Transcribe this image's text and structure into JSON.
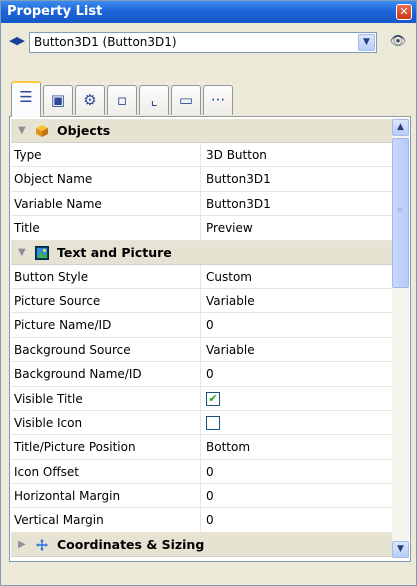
{
  "window": {
    "title": "Property List",
    "close_glyph": "✕"
  },
  "selector": {
    "nav_glyph": "◀▶",
    "selected_object": "Button3D1 (Button3D1)",
    "dropdown_glyph": "▼",
    "eye_glyph": "👁"
  },
  "tabs": [
    {
      "icon": "list-icon",
      "glyph": "☰",
      "active": true
    },
    {
      "icon": "panel-icon",
      "glyph": "▣",
      "active": false
    },
    {
      "icon": "gear-icon",
      "glyph": "⚙",
      "active": false
    },
    {
      "icon": "shapes-icon",
      "glyph": "▫",
      "active": false
    },
    {
      "icon": "chart-icon",
      "glyph": "⌞",
      "active": false
    },
    {
      "icon": "monitor-icon",
      "glyph": "▭",
      "active": false
    },
    {
      "icon": "more-icon",
      "glyph": "···",
      "active": false
    }
  ],
  "grid": {
    "objects": {
      "label": "Objects",
      "toggle": "▼",
      "rows": [
        {
          "name": "Type",
          "value": "3D Button"
        },
        {
          "name": "Object Name",
          "value": "Button3D1"
        },
        {
          "name": "Variable Name",
          "value": "Button3D1"
        },
        {
          "name": "Title",
          "value": "Preview"
        }
      ]
    },
    "text_picture": {
      "label": "Text and Picture",
      "toggle": "▼",
      "rows": [
        {
          "name": "Button Style",
          "value": "Custom"
        },
        {
          "name": "Picture Source",
          "value": "Variable"
        },
        {
          "name": "Picture Name/ID",
          "value": "0"
        },
        {
          "name": "Background Source",
          "value": "Variable"
        },
        {
          "name": "Background Name/ID",
          "value": "0"
        },
        {
          "name": "Visible Title",
          "checked": true,
          "check_glyph": "✔"
        },
        {
          "name": "Visible Icon",
          "checked": false
        },
        {
          "name": "Title/Picture Position",
          "value": "Bottom"
        },
        {
          "name": "Icon Offset",
          "value": "0"
        },
        {
          "name": "Horizontal Margin",
          "value": "0"
        },
        {
          "name": "Vertical Margin",
          "value": "0"
        }
      ]
    },
    "coordinates": {
      "label": "Coordinates & Sizing",
      "toggle": "▶"
    }
  },
  "scrollbar": {
    "up_glyph": "▲",
    "down_glyph": "▼",
    "grip": "≡"
  }
}
